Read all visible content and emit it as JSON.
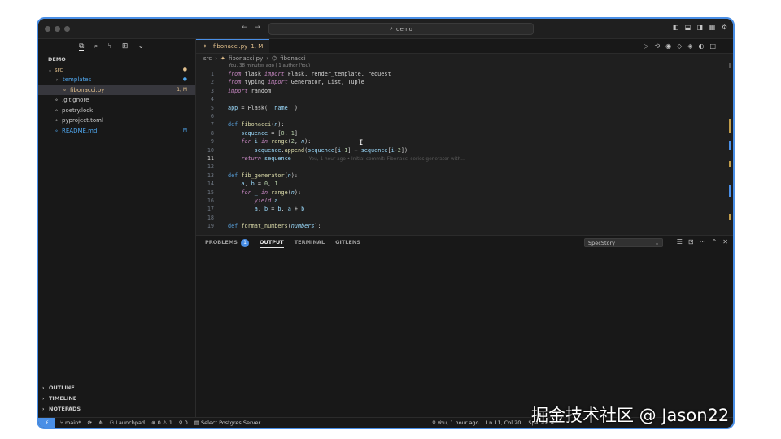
{
  "window": {
    "search_text": "demo",
    "accent_color": "#4a8fe6"
  },
  "sidebar": {
    "root": "DEMO",
    "items": [
      {
        "label": "src",
        "badge": "●",
        "color": "mod",
        "indent": 0,
        "caret": "⌄"
      },
      {
        "label": "templates",
        "badge": "●",
        "color": "blue",
        "indent": 1,
        "caret": "›"
      },
      {
        "label": "fibonacci.py",
        "badge": "1, M",
        "color": "mod",
        "indent": 1,
        "caret": "",
        "icon": "python-file-icon",
        "selected": true
      },
      {
        "label": ".gitignore",
        "badge": "",
        "color": "muted",
        "indent": 0,
        "caret": ""
      },
      {
        "label": "poetry.lock",
        "badge": "",
        "color": "muted",
        "indent": 0,
        "caret": ""
      },
      {
        "label": "pyproject.toml",
        "badge": "",
        "color": "muted",
        "indent": 0,
        "caret": ""
      },
      {
        "label": "README.md",
        "badge": "M",
        "color": "blue",
        "indent": 0,
        "caret": ""
      }
    ],
    "bottom_sections": [
      "OUTLINE",
      "TIMELINE",
      "NOTEPADS"
    ]
  },
  "editor": {
    "tab_label": "fibonacci.py",
    "tab_badge": "1, M",
    "breadcrumb": [
      "src",
      "fibonacci.py",
      "fibonacci"
    ],
    "blame_header": "You, 38 minutes ago | 1 author (You)",
    "ghost_blame": "You, 1 hour ago • Initial commit: Fibonacci series generator with…",
    "current_line": 11
  },
  "panel": {
    "tabs": [
      "PROBLEMS",
      "OUTPUT",
      "TERMINAL",
      "GITLENS"
    ],
    "problems_count": "1",
    "active_tab": "OUTPUT",
    "output_channel": "SpecStory"
  },
  "statusbar": {
    "branch": "main*",
    "launchpad": "Launchpad",
    "errors": "0",
    "warnings": "1",
    "ports": "0",
    "postgres": "Select Postgres Server",
    "blame": "You, 1 hour ago",
    "position": "Ln 11, Col 20",
    "spaces": "Spaces: 4"
  },
  "watermark": "掘金技术社区 @ Jason22"
}
